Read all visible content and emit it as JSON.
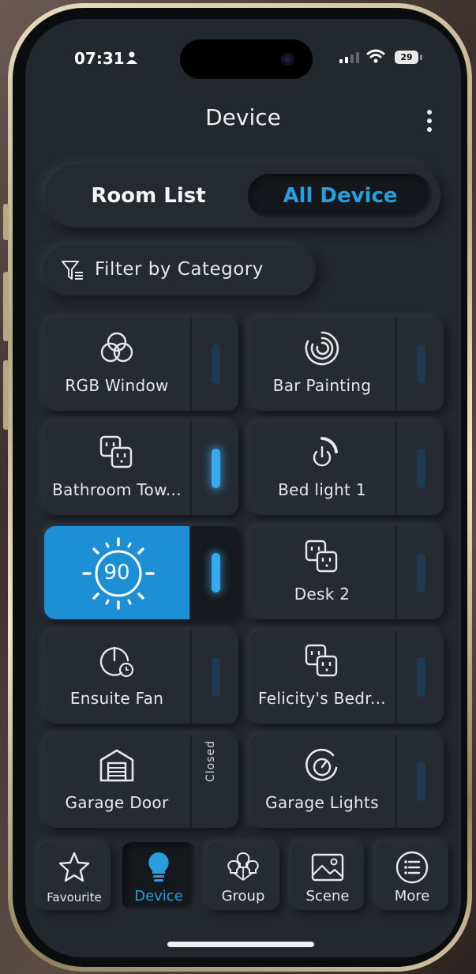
{
  "status_bar": {
    "time": "07:31",
    "battery": "29"
  },
  "header": {
    "title": "Device"
  },
  "segmented": {
    "room_list": "Room List",
    "all_device": "All Device"
  },
  "filter": {
    "label": "Filter by Category"
  },
  "devices": [
    {
      "name": "RGB Window",
      "icon": "rgb-circles-icon",
      "state": "off"
    },
    {
      "name": "Bar Painting",
      "icon": "spiral-icon",
      "state": "off"
    },
    {
      "name": "Bathroom Tow...",
      "icon": "outlet-icon",
      "state": "on"
    },
    {
      "name": "Bed light 1",
      "icon": "power-dimmer-icon",
      "state": "off"
    },
    {
      "name": "",
      "icon": "sun-icon",
      "value": "90",
      "state": "on",
      "selected": true
    },
    {
      "name": "Desk 2",
      "icon": "outlet-icon",
      "state": "off"
    },
    {
      "name": "Ensuite Fan",
      "icon": "timer-icon",
      "state": "off"
    },
    {
      "name": "Felicity's Bedr...",
      "icon": "outlet-icon",
      "state": "off"
    },
    {
      "name": "Garage Door",
      "icon": "garage-icon",
      "state_label": "Closed"
    },
    {
      "name": "Garage Lights",
      "icon": "dial-icon",
      "state": "off"
    }
  ],
  "nav": [
    {
      "label": "Favourite",
      "icon": "star-icon",
      "active": false
    },
    {
      "label": "Device",
      "icon": "bulb-icon",
      "active": true
    },
    {
      "label": "Group",
      "icon": "group-bulbs-icon",
      "active": false
    },
    {
      "label": "Scene",
      "icon": "image-icon",
      "active": false
    },
    {
      "label": "More",
      "icon": "list-circle-icon",
      "active": false
    }
  ],
  "colors": {
    "accent": "#2a9ddf",
    "active_card": "#1d8fd4",
    "background": "#23272e"
  }
}
